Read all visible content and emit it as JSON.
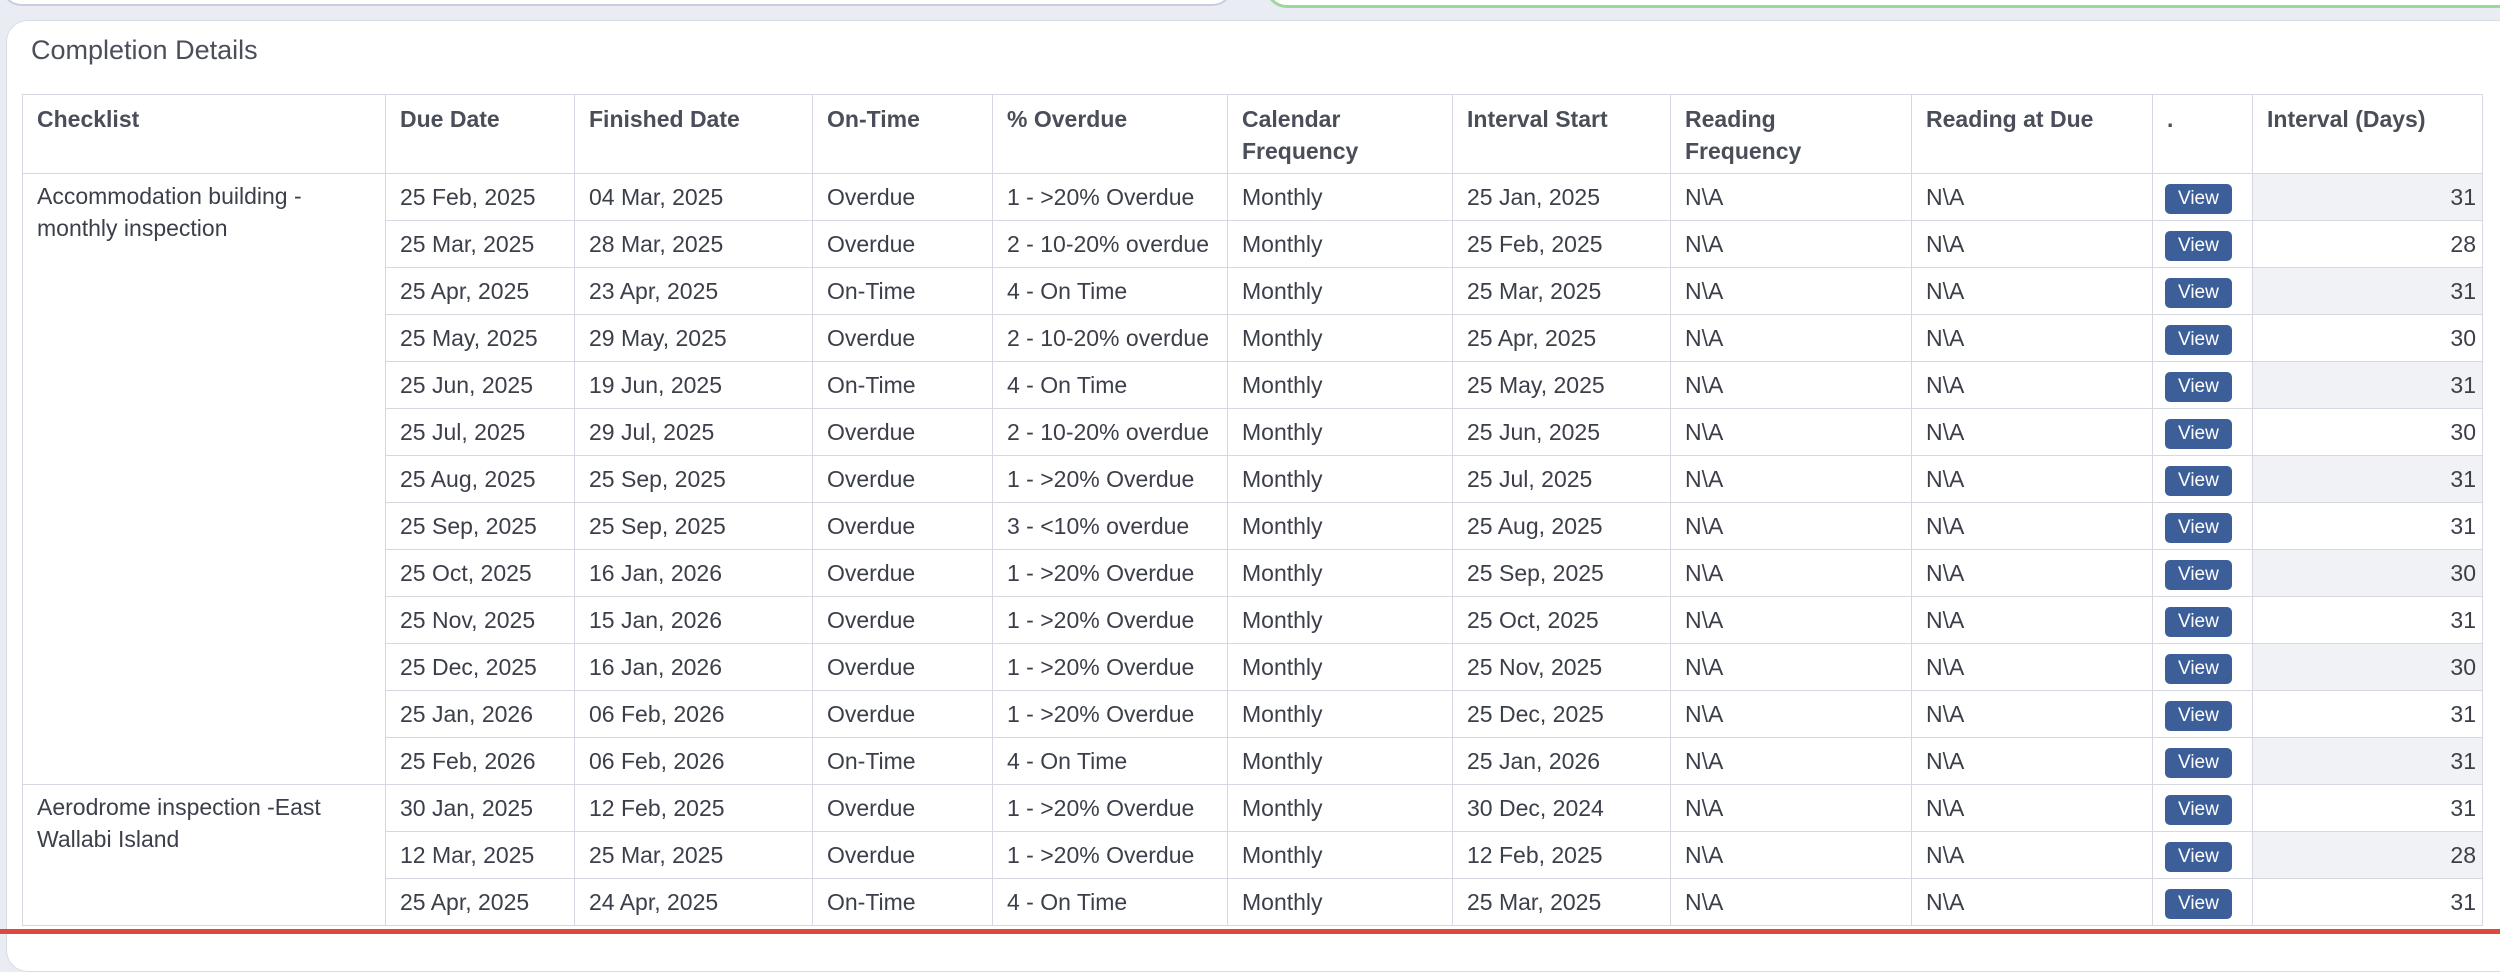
{
  "panel": {
    "title": "Completion Details"
  },
  "columns": [
    "Checklist",
    "Due Date",
    "Finished Date",
    "On-Time",
    "% Overdue",
    "Calendar Frequency",
    "Interval Start",
    "Reading Frequency",
    "Reading at Due",
    ".",
    "Interval (Days)"
  ],
  "groups": [
    {
      "checklist": "Accommodation building - monthly inspection",
      "rows": [
        {
          "due": "25 Feb, 2025",
          "finished": "04 Mar, 2025",
          "ontime": "Overdue",
          "overdue": "1 - >20% Overdue",
          "freq": "Monthly",
          "start": "25 Jan, 2025",
          "reading_freq": "N\\A",
          "reading_due": "N\\A",
          "action": "View",
          "interval": "31"
        },
        {
          "due": "25 Mar, 2025",
          "finished": "28 Mar, 2025",
          "ontime": "Overdue",
          "overdue": "2 - 10-20% overdue",
          "freq": "Monthly",
          "start": "25 Feb, 2025",
          "reading_freq": "N\\A",
          "reading_due": "N\\A",
          "action": "View",
          "interval": "28"
        },
        {
          "due": "25 Apr, 2025",
          "finished": "23 Apr, 2025",
          "ontime": "On-Time",
          "overdue": "4 - On Time",
          "freq": "Monthly",
          "start": "25 Mar, 2025",
          "reading_freq": "N\\A",
          "reading_due": "N\\A",
          "action": "View",
          "interval": "31"
        },
        {
          "due": "25 May, 2025",
          "finished": "29 May, 2025",
          "ontime": "Overdue",
          "overdue": "2 - 10-20% overdue",
          "freq": "Monthly",
          "start": "25 Apr, 2025",
          "reading_freq": "N\\A",
          "reading_due": "N\\A",
          "action": "View",
          "interval": "30"
        },
        {
          "due": "25 Jun, 2025",
          "finished": "19 Jun, 2025",
          "ontime": "On-Time",
          "overdue": "4 - On Time",
          "freq": "Monthly",
          "start": "25 May, 2025",
          "reading_freq": "N\\A",
          "reading_due": "N\\A",
          "action": "View",
          "interval": "31"
        },
        {
          "due": "25 Jul, 2025",
          "finished": "29 Jul, 2025",
          "ontime": "Overdue",
          "overdue": "2 - 10-20% overdue",
          "freq": "Monthly",
          "start": "25 Jun, 2025",
          "reading_freq": "N\\A",
          "reading_due": "N\\A",
          "action": "View",
          "interval": "30"
        },
        {
          "due": "25 Aug, 2025",
          "finished": "25 Sep, 2025",
          "ontime": "Overdue",
          "overdue": "1 - >20% Overdue",
          "freq": "Monthly",
          "start": "25 Jul, 2025",
          "reading_freq": "N\\A",
          "reading_due": "N\\A",
          "action": "View",
          "interval": "31"
        },
        {
          "due": "25 Sep, 2025",
          "finished": "25 Sep, 2025",
          "ontime": "Overdue",
          "overdue": "3 - <10% overdue",
          "freq": "Monthly",
          "start": "25 Aug, 2025",
          "reading_freq": "N\\A",
          "reading_due": "N\\A",
          "action": "View",
          "interval": "31"
        },
        {
          "due": "25 Oct, 2025",
          "finished": "16 Jan, 2026",
          "ontime": "Overdue",
          "overdue": "1 - >20% Overdue",
          "freq": "Monthly",
          "start": "25 Sep, 2025",
          "reading_freq": "N\\A",
          "reading_due": "N\\A",
          "action": "View",
          "interval": "30"
        },
        {
          "due": "25 Nov, 2025",
          "finished": "15 Jan, 2026",
          "ontime": "Overdue",
          "overdue": "1 - >20% Overdue",
          "freq": "Monthly",
          "start": "25 Oct, 2025",
          "reading_freq": "N\\A",
          "reading_due": "N\\A",
          "action": "View",
          "interval": "31"
        },
        {
          "due": "25 Dec, 2025",
          "finished": "16 Jan, 2026",
          "ontime": "Overdue",
          "overdue": "1 - >20% Overdue",
          "freq": "Monthly",
          "start": "25 Nov, 2025",
          "reading_freq": "N\\A",
          "reading_due": "N\\A",
          "action": "View",
          "interval": "30"
        },
        {
          "due": "25 Jan, 2026",
          "finished": "06 Feb, 2026",
          "ontime": "Overdue",
          "overdue": "1 - >20% Overdue",
          "freq": "Monthly",
          "start": "25 Dec, 2025",
          "reading_freq": "N\\A",
          "reading_due": "N\\A",
          "action": "View",
          "interval": "31"
        },
        {
          "due": "25 Feb, 2026",
          "finished": "06 Feb, 2026",
          "ontime": "On-Time",
          "overdue": "4 - On Time",
          "freq": "Monthly",
          "start": "25 Jan, 2026",
          "reading_freq": "N\\A",
          "reading_due": "N\\A",
          "action": "View",
          "interval": "31"
        }
      ]
    },
    {
      "checklist": "Aerodrome inspection -East Wallabi Island",
      "rows": [
        {
          "due": "30 Jan, 2025",
          "finished": "12 Feb, 2025",
          "ontime": "Overdue",
          "overdue": "1 - >20% Overdue",
          "freq": "Monthly",
          "start": "30 Dec, 2024",
          "reading_freq": "N\\A",
          "reading_due": "N\\A",
          "action": "View",
          "interval": "31"
        },
        {
          "due": "12 Mar, 2025",
          "finished": "25 Mar, 2025",
          "ontime": "Overdue",
          "overdue": "1 - >20% Overdue",
          "freq": "Monthly",
          "start": "12 Feb, 2025",
          "reading_freq": "N\\A",
          "reading_due": "N\\A",
          "action": "View",
          "interval": "28"
        },
        {
          "due": "25 Apr, 2025",
          "finished": "24 Apr, 2025",
          "ontime": "On-Time",
          "overdue": "4 - On Time",
          "freq": "Monthly",
          "start": "25 Mar, 2025",
          "reading_freq": "N\\A",
          "reading_due": "N\\A",
          "action": "View",
          "interval": "31"
        }
      ]
    }
  ]
}
